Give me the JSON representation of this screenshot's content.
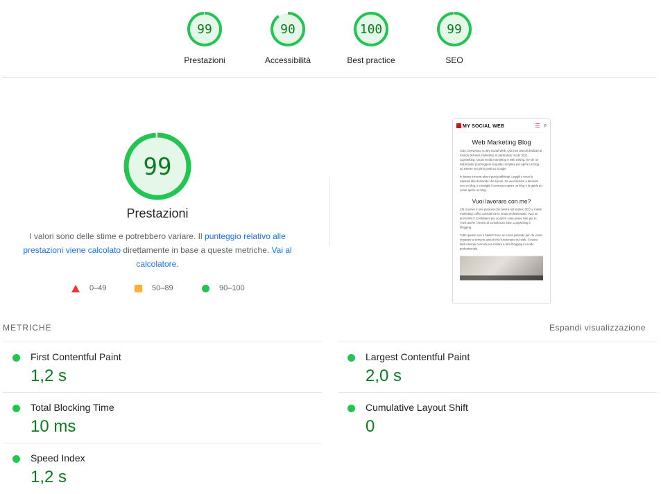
{
  "summary_gauges": [
    {
      "score": "99",
      "label": "Prestazioni",
      "fraction": 0.99
    },
    {
      "score": "90",
      "label": "Accessibilità",
      "fraction": 0.9
    },
    {
      "score": "100",
      "label": "Best practice",
      "fraction": 1.0
    },
    {
      "score": "99",
      "label": "SEO",
      "fraction": 0.99
    }
  ],
  "performance": {
    "score": "99",
    "fraction": 0.99,
    "title": "Prestazioni",
    "desc_part1": "I valori sono delle stime e potrebbero variare. Il ",
    "desc_link1": "punteggio relativo alle prestazioni viene calcolato",
    "desc_part2": " direttamente in base a queste metriche. ",
    "desc_link2": "Vai al calcolatore",
    "desc_part3": "."
  },
  "legend": [
    {
      "shape": "triangle",
      "range": "0–49"
    },
    {
      "shape": "square",
      "range": "50–89"
    },
    {
      "shape": "circle",
      "range": "90–100"
    }
  ],
  "colors": {
    "pass": "#0c7a1e",
    "pass_fill": "#e5f7e9",
    "pass_ring": "#23c552",
    "average": "#fbb03b",
    "fail": "#e53935",
    "link": "#1a73e8"
  },
  "screenshot": {
    "logo": "MY SOCIAL WEB",
    "heading1": "Web Marketing Blog",
    "para1": "Ciao, benvenuto su My Social Web. Qui trovi articoli dedicati al mondo del web marketing, in particolare modo SEO, copywriting, social media marketing e web writing. Se sei un webmaster puoi leggere la guida completa per aprire un blog ed essere nei primi posti su Google.",
    "para2": "In basso troverai alcuni post pubblicati. Leggili e trova le risposte alle domande che ti poni. Se vuoi iniziare a lavorare con un blog, ti consiglio il corso per aprire un blog o la guida su come aprire un blog.",
    "heading2": "Vuoi lavorare con me?",
    "para3": "Chi ti scrive è una persona che lavora nel settore SEO e il web marketing. Offro consulenze in modo professionale. Vuoi un preventivo? Contattami per scoprire cosa posso fare per te. Trovi anche i servizi di consulenza SEO, copywriting e blogging.",
    "para4": "Tutto questo non ti basta? Ecco un corso pensato per chi vuole imparare a scrivere articoli che funzionano sul web. Ci sono tanti esempi concreti per iniziare a fare blogging in modo professionale."
  },
  "metrics": {
    "header": "METRICHE",
    "expand": "Espandi visualizzazione",
    "items": [
      {
        "name": "First Contentful Paint",
        "value": "1,2 s"
      },
      {
        "name": "Largest Contentful Paint",
        "value": "2,0 s"
      },
      {
        "name": "Total Blocking Time",
        "value": "10 ms"
      },
      {
        "name": "Cumulative Layout Shift",
        "value": "0"
      },
      {
        "name": "Speed Index",
        "value": "1,2 s"
      }
    ]
  }
}
